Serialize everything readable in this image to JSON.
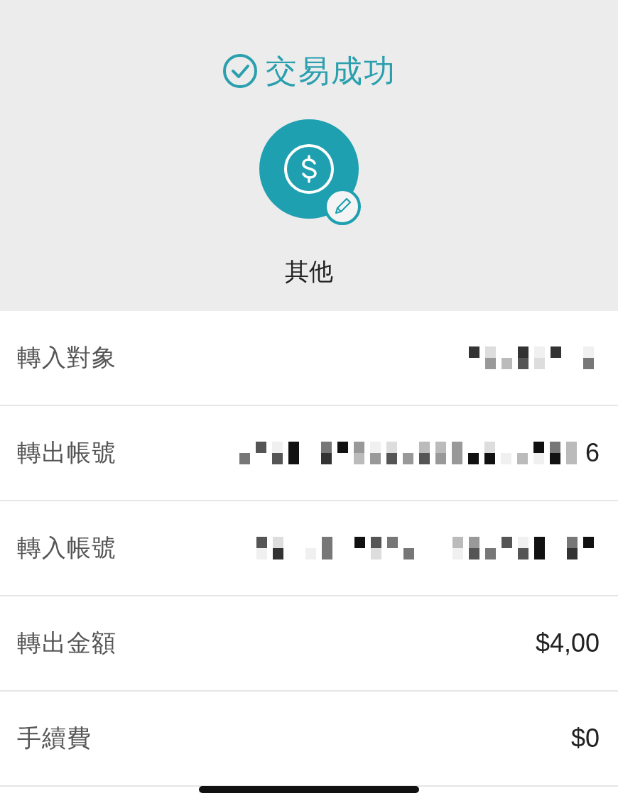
{
  "header": {
    "status": "交易成功",
    "category": "其他"
  },
  "rows": [
    {
      "label": "轉入對象",
      "redacted": true
    },
    {
      "label": "轉出帳號",
      "redacted": true,
      "value": "6"
    },
    {
      "label": "轉入帳號",
      "redacted": true
    },
    {
      "label": "轉出金額",
      "redacted": false,
      "value": "$4,00"
    },
    {
      "label": "手續費",
      "redacted": false,
      "value": "$0"
    }
  ]
}
